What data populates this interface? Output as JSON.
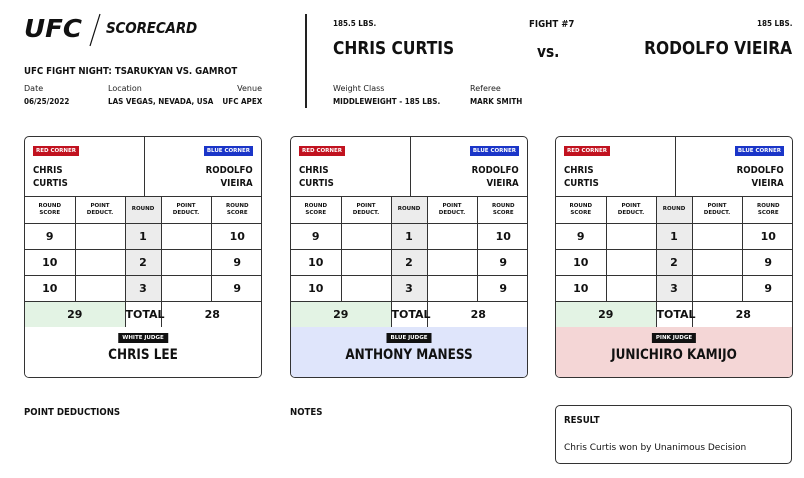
{
  "header": {
    "logo_text": "UFC",
    "title": "SCORECARD",
    "event_name": "UFC FIGHT NIGHT: TSARUKYAN VS. GAMROT",
    "date_label": "Date",
    "date": "06/25/2022",
    "location_label": "Location",
    "location": "LAS VEGAS, NEVADA, USA",
    "venue_label": "Venue",
    "venue": "UFC APEX",
    "red_weight": "185.5 LBS.",
    "red_fighter": "CHRIS CURTIS",
    "fight_number": "FIGHT #7",
    "vs": "vs.",
    "blue_weight": "185 LBS.",
    "blue_fighter": "RODOLFO VIEIRA",
    "weight_class_label": "Weight Class",
    "weight_class": "MIDDLEWEIGHT - 185 LBS.",
    "referee_label": "Referee",
    "referee": "MARK SMITH"
  },
  "table_labels": {
    "red_corner": "RED CORNER",
    "blue_corner": "BLUE CORNER",
    "round_score_1": "ROUND",
    "round_score_2": "SCORE",
    "point_deduct_1": "POINT",
    "point_deduct_2": "DEDUCT.",
    "round": "ROUND",
    "total": "TOTAL",
    "red_first": "CHRIS",
    "red_last": "CURTIS",
    "blue_first": "RODOLFO",
    "blue_last": "VIEIRA"
  },
  "cards": [
    {
      "judge_label": "WHITE JUDGE",
      "judge_name": "CHRIS LEE",
      "judge_color": "#ffffff",
      "rounds": [
        {
          "round": "1",
          "red_score": "9",
          "red_deduct": "",
          "blue_deduct": "",
          "blue_score": "10"
        },
        {
          "round": "2",
          "red_score": "10",
          "red_deduct": "",
          "blue_deduct": "",
          "blue_score": "9"
        },
        {
          "round": "3",
          "red_score": "10",
          "red_deduct": "",
          "blue_deduct": "",
          "blue_score": "9"
        }
      ],
      "red_total": "29",
      "blue_total": "28"
    },
    {
      "judge_label": "BLUE JUDGE",
      "judge_name": "ANTHONY MANESS",
      "judge_color": "#dfe5fb",
      "rounds": [
        {
          "round": "1",
          "red_score": "9",
          "red_deduct": "",
          "blue_deduct": "",
          "blue_score": "10"
        },
        {
          "round": "2",
          "red_score": "10",
          "red_deduct": "",
          "blue_deduct": "",
          "blue_score": "9"
        },
        {
          "round": "3",
          "red_score": "10",
          "red_deduct": "",
          "blue_deduct": "",
          "blue_score": "9"
        }
      ],
      "red_total": "29",
      "blue_total": "28"
    },
    {
      "judge_label": "PINK JUDGE",
      "judge_name": "JUNICHIRO KAMIJO",
      "judge_color": "#f4d6d6",
      "rounds": [
        {
          "round": "1",
          "red_score": "9",
          "red_deduct": "",
          "blue_deduct": "",
          "blue_score": "10"
        },
        {
          "round": "2",
          "red_score": "10",
          "red_deduct": "",
          "blue_deduct": "",
          "blue_score": "9"
        },
        {
          "round": "3",
          "red_score": "10",
          "red_deduct": "",
          "blue_deduct": "",
          "blue_score": "9"
        }
      ],
      "red_total": "29",
      "blue_total": "28"
    }
  ],
  "footer": {
    "point_deductions_title": "POINT DEDUCTIONS",
    "notes_title": "NOTES",
    "result_title": "RESULT",
    "result_text": "Chris Curtis won by Unanimous Decision"
  },
  "colors": {
    "red_corner": "#c1121f",
    "blue_corner": "#1a35c8",
    "red_total_bg": "#e3f3e4"
  }
}
